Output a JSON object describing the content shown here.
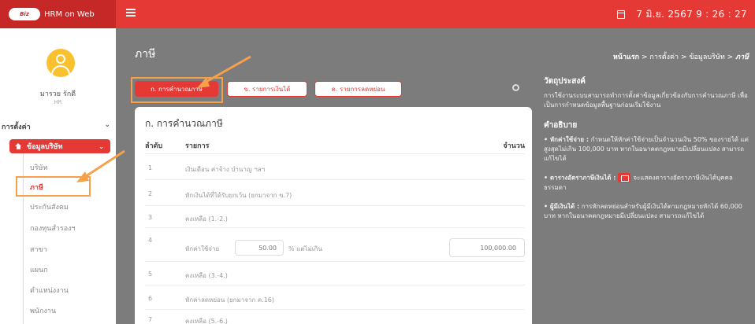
{
  "app": {
    "title": "HRM on Web",
    "logo_text": "Biz"
  },
  "header": {
    "datetime": "7 มิ.ย. 2567  9 : 26 : 27"
  },
  "user": {
    "name": "มารวย รักดี",
    "role": "HR"
  },
  "sidebar": {
    "section": "การตั้งค่า",
    "group": "ข้อมูลบริษัท",
    "items": [
      "บริษัท",
      "ภาษี",
      "ประกันสังคม",
      "กองทุนสำรองฯ",
      "สาขา",
      "แผนก",
      "ตำแหน่งงาน",
      "พนักงาน"
    ]
  },
  "page": {
    "title": "ภาษี",
    "breadcrumb": {
      "home": "หน้าแรก",
      "sep": ">",
      "b2": "การตั้งค่า",
      "b3": "ข้อมูลบริษัท",
      "current": "ภาษี"
    }
  },
  "tabs": [
    "ก. การคำนวณภาษี",
    "ข. รายการเงินได้",
    "ค. รายการลดหย่อน"
  ],
  "card": {
    "title": "ก. การคำนวณภาษี",
    "headers": {
      "no": "ลำดับ",
      "item": "รายการ",
      "amount": "จำนวน"
    },
    "rows": [
      {
        "no": "1",
        "item": "เงินเดือน ค่าจ้าง บำนาญ ฯลฯ"
      },
      {
        "no": "2",
        "item": "หักเงินได้ที่ได้รับยกเว้น (ยกมาจาก ข.7)"
      },
      {
        "no": "3",
        "item": "คงเหลือ (1.-2.)"
      },
      {
        "no": "4",
        "item": "หักค่าใช้จ่าย",
        "percent": "50.00",
        "suffix": "% แต่ไม่เกิน",
        "amount": "100,000.00"
      },
      {
        "no": "5",
        "item": "คงเหลือ (3.-4.)"
      },
      {
        "no": "6",
        "item": "หักค่าลดหย่อน (ยกมาจาก ค.16)"
      },
      {
        "no": "7",
        "item": "คงเหลือ (5.-6.)"
      }
    ]
  },
  "info": {
    "objective_title": "วัตถุประสงค์",
    "objective_text": "การใช้งานระบบสามารถทำการตั้งค่าข้อมูลเกี่ยวข้องกับการคำนวณภาษี เพื่อเป็นการกำหนดข้อมูลพื้นฐานก่อนเริ่มใช้งาน",
    "desc_title": "คำอธิบาย",
    "b1_label": "• หักค่าใช้จ่าย :",
    "b1_text": " กำหนดให้หักค่าใช้จ่ายเป็นจำนวนเงิน 50% ของรายได้ แต่สูงสุดไม่เกิน 100,000 บาท หากในอนาคตกฎหมายมีเปลี่ยนแปลง สามารถแก้ไขได้",
    "b2_label": "• ตารางอัตราภาษีเงินได้ :",
    "b2_text": "จะแสดงตารางอัตราภาษีเงินได้บุคคลธรรมดา",
    "b3_label": "• ผู้มีเงินได้ :",
    "b3_text": " การหักลดหย่อนสำหรับผู้มีเงินได้ตามกฎหมายหักได้ 60,000 บาท หากในอนาคตกฎหมายมีเปลี่ยนแปลง สามารถแก้ไขได้"
  },
  "colors": {
    "accent": "#e53935",
    "highlight": "#f5a04a"
  }
}
